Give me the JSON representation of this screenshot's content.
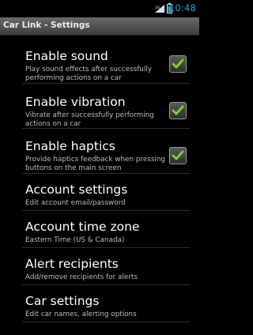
{
  "status_bar": {
    "time": "10:48",
    "signal_label": "3G"
  },
  "header": {
    "title": "Car Link - Settings"
  },
  "settings": [
    {
      "title": "Enable sound",
      "summary": "Play sound effects after successfully performing actions on a car",
      "checked": true
    },
    {
      "title": "Enable vibration",
      "summary": "Vibrate after successfully performing actions on a car",
      "checked": true
    },
    {
      "title": "Enable haptics",
      "summary": "Provide haptics feedback when pressing buttons on the main screen",
      "checked": true
    },
    {
      "title": "Account settings",
      "summary": "Edit account email/password"
    },
    {
      "title": "Account time zone",
      "summary": "Eastern Time (US & Canada)"
    },
    {
      "title": "Alert recipients",
      "summary": "Add/remove recipients for alerts"
    },
    {
      "title": "Car settings",
      "summary": "Edit car names, alerting options"
    }
  ],
  "colors": {
    "accent": "#2a9fd6",
    "check_green": "#7ccf2c"
  }
}
